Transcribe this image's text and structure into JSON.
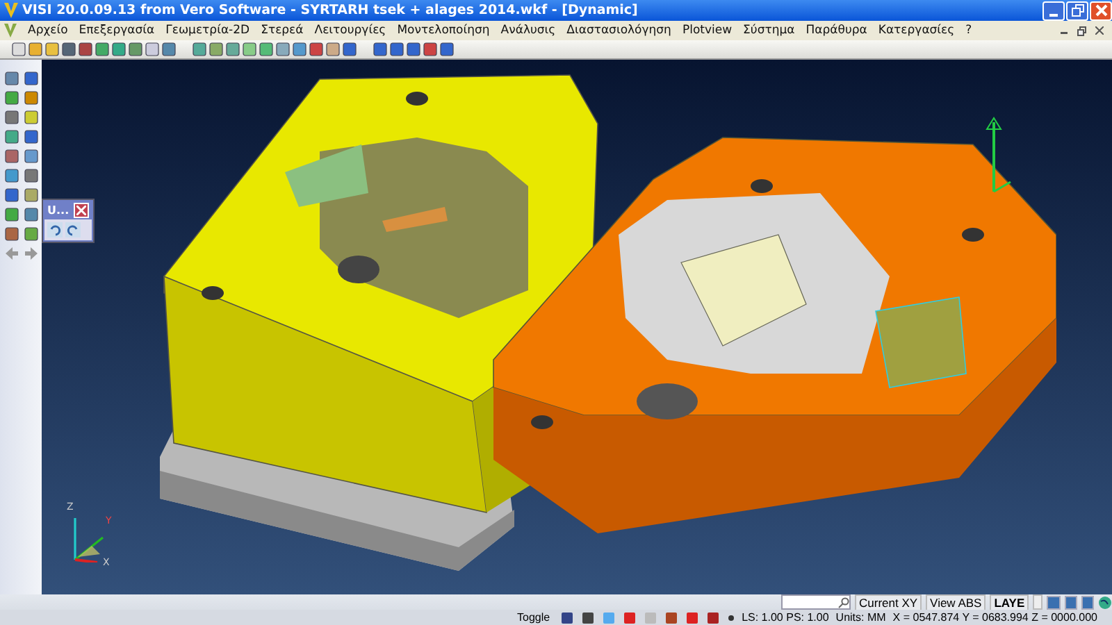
{
  "window": {
    "title": "VISI 20.0.09.13 from Vero Software - SYRTARH tsek + alages 2014.wkf - [Dynamic]"
  },
  "menu": [
    "Αρχείο",
    "Επεξεργασία",
    "Γεωμετρία-2D",
    "Στερεά",
    "Λειτουργίες",
    "Μοντελοποίηση",
    "Ανάλυσις",
    "Διαστασιολόγηση",
    "Plotview",
    "Σύστημα",
    "Παράθυρα",
    "Κατεργασίες",
    "?"
  ],
  "floating_toolbar": {
    "title": "U..."
  },
  "axis_labels": [
    "Z",
    "Y",
    "X"
  ],
  "status_bar": {
    "top": [
      "Current XY",
      "View ABS",
      "LAYE"
    ],
    "toggle": "Toggle",
    "scale": "LS: 1.00 PS: 1.00",
    "units": "Units: MM",
    "coordinates": "X = 0547.874 Y = 0683.994 Z = 0000.000"
  }
}
